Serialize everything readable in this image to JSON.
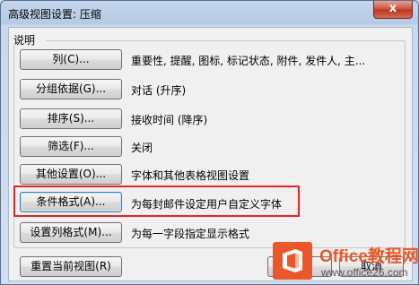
{
  "window": {
    "title": "高级视图设置: 压缩",
    "close": "x"
  },
  "group": {
    "label": "说明"
  },
  "rows": [
    {
      "button": "列(C)...",
      "desc": "重要性, 提醒, 图标, 标记状态, 附件, 发件人, 主..."
    },
    {
      "button": "分组依据(G)...",
      "desc": "对话 (升序)"
    },
    {
      "button": "排序(S)...",
      "desc": "接收时间 (降序)"
    },
    {
      "button": "筛选(F)...",
      "desc": "关闭"
    },
    {
      "button": "其他设置(O)...",
      "desc": "字体和其他表格视图设置"
    },
    {
      "button": "条件格式(A)...",
      "desc": "为每封邮件设定用户自定义字体"
    },
    {
      "button": "设置列格式(M)...",
      "desc": "为每一字段指定显示格式"
    }
  ],
  "footer": {
    "reset": "重置当前视图(R)",
    "ok": "确",
    "cancel": "取消"
  },
  "watermark": {
    "name": "Office教程网",
    "url": "www.office26.com",
    "accent": "#e9572b"
  }
}
